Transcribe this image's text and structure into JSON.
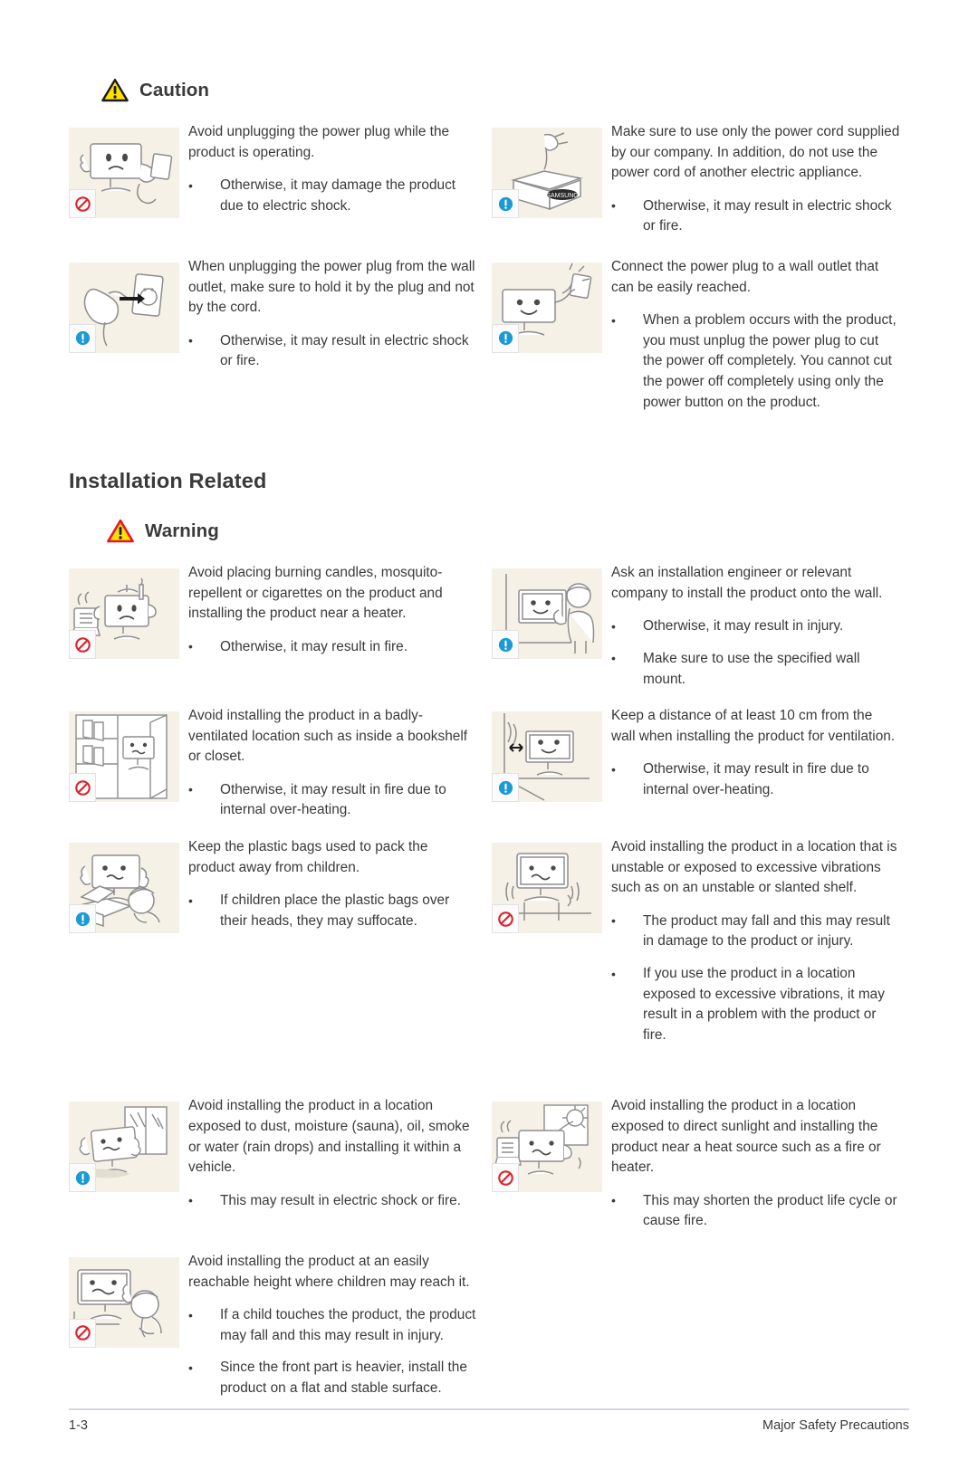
{
  "document": {
    "caution_heading": "Caution",
    "section_title": "Installation Related",
    "warning_heading": "Warning"
  },
  "icons": {
    "caution_triangle": "warning-triangle-black-icon",
    "warning_triangle": "warning-triangle-red-icon",
    "prohibited": "prohibition-icon",
    "mandatory": "mandatory-exclamation-icon"
  },
  "colors": {
    "triangle_fill": "#FFE100",
    "caution_border": "#1a1a1a",
    "warning_border": "#E8152A",
    "prohibited": "#D9242B",
    "mandatory": "#1C9AD6",
    "thumb_background": "#f6f1e6",
    "text": "#3a3a3a"
  },
  "caution_section": {
    "rows": [
      {
        "left": {
          "badge": "prohibited",
          "illustration": "monitor-unplugging-cord",
          "lead": "Avoid unplugging the power plug while the product is operating.",
          "bullets": [
            "Otherwise, it may damage the product due to electric shock."
          ]
        },
        "right": {
          "badge": "mandatory",
          "illustration": "power-cord-in-box",
          "lead": "Make sure to use only the power cord supplied by our company. In addition, do not use the power cord of another electric appliance.",
          "bullets": [
            "Otherwise, it may result in electric shock or fire."
          ]
        }
      },
      {
        "left": {
          "badge": "mandatory",
          "illustration": "hand-pulling-plug-from-outlet",
          "lead": "When unplugging the power plug from the wall outlet, make sure to hold it by the plug and not by the cord.",
          "bullets": [
            "Otherwise, it may result in electric shock or fire."
          ]
        },
        "right": {
          "badge": "mandatory",
          "illustration": "monitor-plugged-to-wall-outlet",
          "lead": "Connect the power plug to a wall outlet that can be easily reached.",
          "bullets": [
            "When a problem occurs with the product, you must unplug the power plug to cut the power off completely. You cannot cut the power off completely using only the power button on the product."
          ]
        }
      }
    ]
  },
  "warning_section": {
    "rows": [
      {
        "left": {
          "badge": "prohibited",
          "illustration": "monitor-near-heater-and-candles",
          "lead": "Avoid placing burning candles,  mosquito-repellent or cigarettes on the product and installing the product near a heater.",
          "bullets": [
            "Otherwise, it may result in fire."
          ]
        },
        "right": {
          "badge": "mandatory",
          "illustration": "engineer-installing-wall-mount",
          "lead": "Ask an installation engineer or relevant company to install the product onto the wall.",
          "bullets": [
            "Otherwise, it may result in injury.",
            "Make sure to use the specified wall mount."
          ]
        }
      },
      {
        "left": {
          "badge": "prohibited",
          "illustration": "monitor-inside-bookshelf",
          "lead": "Avoid installing the product in a badly-ventilated location such as inside a bookshelf or closet.",
          "bullets": [
            "Otherwise, it may result in fire due to internal over-heating."
          ]
        },
        "right": {
          "badge": "mandatory",
          "illustration": "monitor-distance-from-wall",
          "lead": "Keep a distance of at least 10 cm from the wall when installing the product for ventilation.",
          "bullets": [
            "Otherwise, it may result in fire due to internal over-heating."
          ]
        }
      },
      {
        "left": {
          "badge": "mandatory",
          "illustration": "child-with-plastic-bags",
          "lead": "Keep the plastic bags used to pack the product away from children.",
          "bullets": [
            " If children place the plastic bags over their heads, they may suffocate."
          ]
        },
        "right": {
          "badge": "prohibited",
          "illustration": "monitor-on-unstable-shelf",
          "lead": "Avoid installing the product in a location that is unstable or exposed to excessive vibrations such as on an unstable or slanted shelf.",
          "bullets": [
            "The product may fall and this may result in damage to the product or injury.",
            "If you use the product in a location exposed to excessive vibrations, it may result in a problem with the product or fire."
          ]
        }
      },
      {
        "left": {
          "badge": "mandatory",
          "illustration": "monitor-exposed-to-rain",
          "lead": "Avoid installing the product in a location exposed to dust, moisture (sauna), oil, smoke or water (rain drops) and installing it within a vehicle.",
          "bullets": [
            "This may result in electric shock or fire."
          ]
        },
        "right": {
          "badge": "prohibited",
          "illustration": "monitor-in-direct-sunlight-near-heater",
          "lead": "Avoid installing the product in a location exposed to direct sunlight and installing the product near a heat source such as a fire or heater.",
          "bullets": [
            "This may shorten the product life cycle or cause fire."
          ]
        }
      },
      {
        "left": {
          "badge": "prohibited",
          "illustration": "child-reaching-monitor",
          "lead": "Avoid installing the product at an easily reachable height where children may reach it.",
          "bullets": [
            "If a child touches the product, the product may fall and this may result in injury.",
            "Since the front part is heavier, install the product on a flat and stable surface."
          ]
        },
        "right": null
      }
    ]
  },
  "footer": {
    "page_number": "1-3",
    "chapter": "Major Safety Precautions"
  }
}
